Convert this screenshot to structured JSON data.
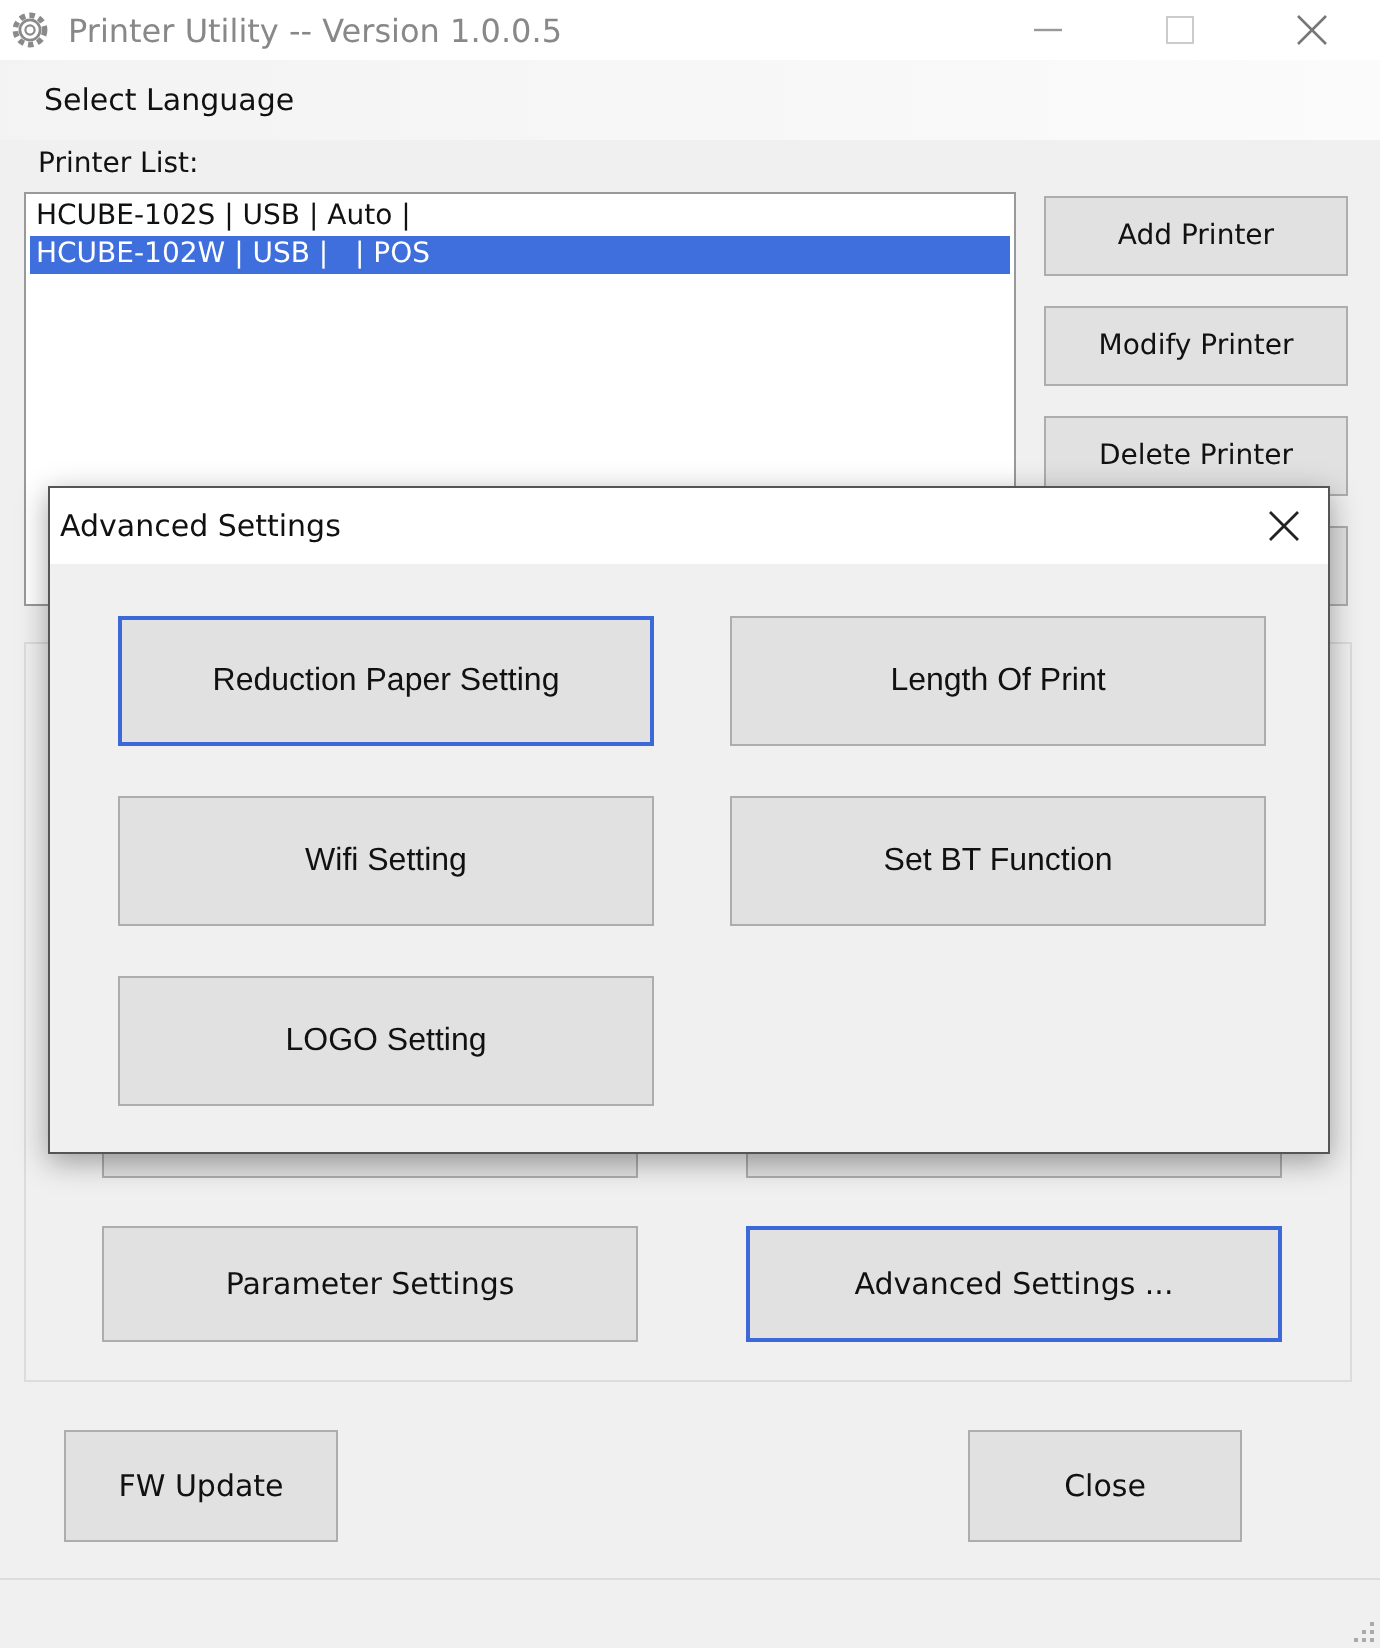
{
  "window": {
    "title": "Printer Utility -- Version 1.0.0.5"
  },
  "menu": [
    "Select Language"
  ],
  "printer_list": {
    "label": "Printer List:",
    "items": [
      {
        "text": "HCUBE-102S | USB | Auto |",
        "selected": false
      },
      {
        "text": "HCUBE-102W | USB |   | POS",
        "selected": true
      }
    ]
  },
  "side_buttons": [
    "Add Printer",
    "Modify Printer",
    "Delete Printer"
  ],
  "group_buttons": [
    {
      "label": "Parameter Settings",
      "focused": false
    },
    {
      "label": "Advanced Settings ...",
      "focused": true
    }
  ],
  "footer_buttons": [
    "FW Update",
    "Close"
  ],
  "dialog": {
    "title": "Advanced Settings",
    "buttons": [
      {
        "label": "Reduction Paper Setting",
        "focused": true
      },
      {
        "label": "Length Of Print",
        "focused": false
      },
      {
        "label": "Wifi Setting",
        "focused": false
      },
      {
        "label": "Set BT Function",
        "focused": false
      },
      {
        "label": "LOGO Setting",
        "focused": false
      }
    ]
  }
}
